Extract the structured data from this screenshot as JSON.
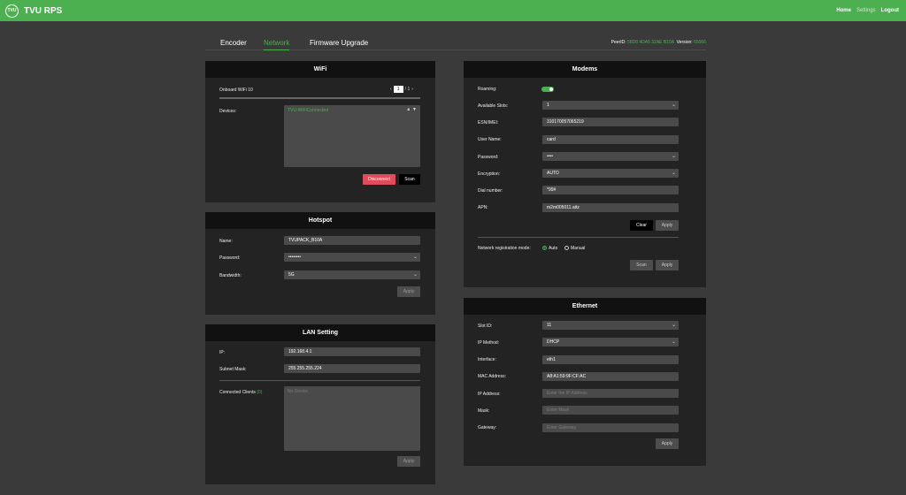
{
  "header": {
    "logo_text": "TVU",
    "title": "TVU RPS",
    "nav": [
      "Home",
      "Settings",
      "Logout"
    ]
  },
  "tabs": [
    "Encoder",
    "Network",
    "Firmware Upgrade"
  ],
  "peer": {
    "label": "PeerID:",
    "id": "58D8 4DA5 32AE B10A",
    "version_label": "Version:",
    "version": "65066"
  },
  "wifi": {
    "title": "WiFi",
    "onboard": "Onboard WiFi 10",
    "page": "1",
    "page_total": "/ 1",
    "devices_label": "Devices:",
    "device": "TVU-WiFiConnected",
    "disconnect": "Disconnect",
    "scan": "Scan"
  },
  "hotspot": {
    "title": "Hotspot",
    "name_label": "Name:",
    "name": "TVUPACK_B10A",
    "password_label": "Password:",
    "password": "••••••••",
    "bandwidth_label": "Bandwidth:",
    "bandwidth": "5G",
    "apply": "Apply"
  },
  "lan": {
    "title": "LAN Setting",
    "ip_label": "IP:",
    "ip": "192.168.4.1",
    "mask_label": "Subnet Mask:",
    "mask": "255.255.255.224",
    "clients_label": "Connected Clients",
    "clients_count": "(0)",
    "clients_placeholder": "No Device",
    "apply": "Apply"
  },
  "modems": {
    "title": "Modems",
    "roaming_label": "Roaming:",
    "slots_label": "Available Slots:",
    "slots": "1",
    "esn_label": "ESN/IMEI:",
    "esn": "310170057065219",
    "user_label": "User Name:",
    "user": "card",
    "password_label": "Password:",
    "password": "••••",
    "enc_label": "Encryption:",
    "enc": "AUTO",
    "dial_label": "Dial number:",
    "dial": "*99#",
    "apn_label": "APN:",
    "apn": "m2m005011.attz",
    "clear": "Clear",
    "apply": "Apply",
    "reg_label": "Network registration mode:",
    "auto": "Auto",
    "manual": "Manual",
    "scan": "Scan",
    "apply2": "Apply"
  },
  "ethernet": {
    "title": "Ethernet",
    "slot_label": "Slot ID:",
    "slot": "11",
    "method_label": "IP Method:",
    "method": "DHCP",
    "iface_label": "Interface:",
    "iface": "eth1",
    "mac_label": "MAC Address:",
    "mac": "A8:A1:59:9F:CF:AC",
    "ip_label": "IP Address:",
    "ip_placeholder": "Enter the IP Address",
    "mask_label": "Mask:",
    "mask_placeholder": "Enter Mask",
    "gw_label": "Gateway:",
    "gw_placeholder": "Enter Gateway",
    "apply": "Apply"
  },
  "colors": {
    "accent": "#4caf50",
    "panel": "#232323",
    "panel_header": "#111111",
    "page_bg": "#3a3a3a",
    "danger": "#e04c5c"
  }
}
